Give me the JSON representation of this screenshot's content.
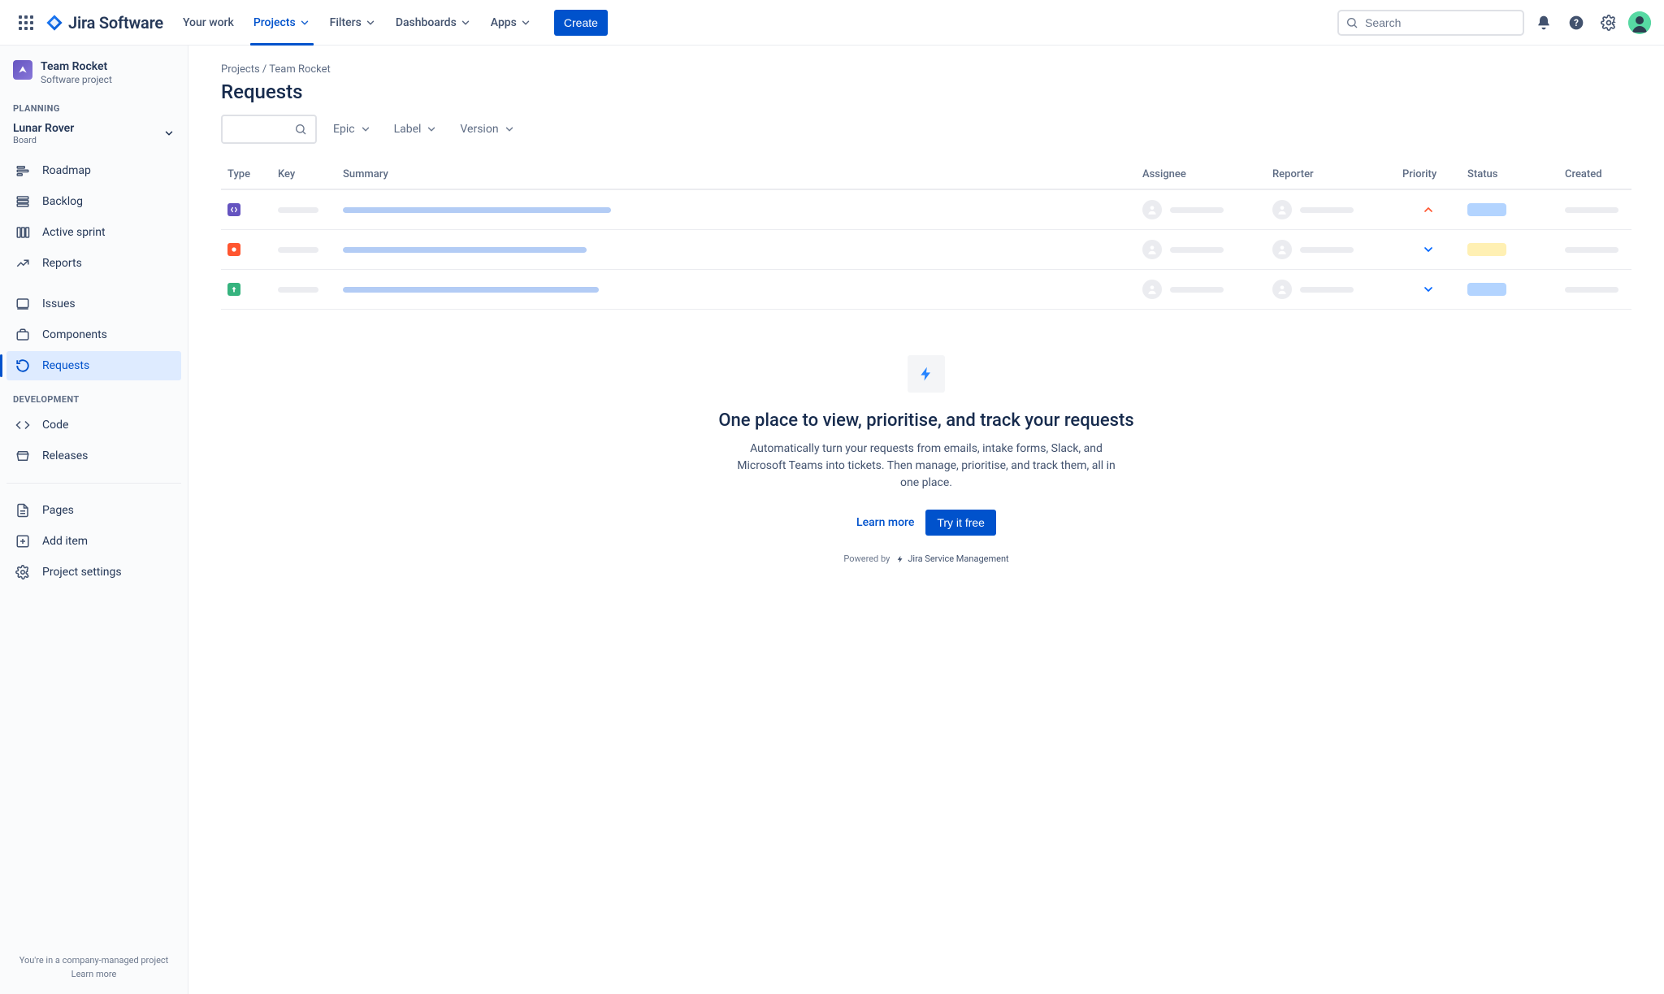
{
  "brand": {
    "name": "Jira Software"
  },
  "topnav": {
    "items": [
      {
        "label": "Your work",
        "dropdown": false,
        "active": false
      },
      {
        "label": "Projects",
        "dropdown": true,
        "active": true
      },
      {
        "label": "Filters",
        "dropdown": true,
        "active": false
      },
      {
        "label": "Dashboards",
        "dropdown": true,
        "active": false
      },
      {
        "label": "Apps",
        "dropdown": true,
        "active": false
      }
    ],
    "create_label": "Create",
    "search_placeholder": "Search"
  },
  "sidebar": {
    "project": {
      "name": "Team Rocket",
      "type": "Software project"
    },
    "sections": {
      "planning_label": "PLANNING",
      "development_label": "DEVELOPMENT"
    },
    "board": {
      "name": "Lunar Rover",
      "subtitle": "Board"
    },
    "planning_items": [
      {
        "icon": "roadmap",
        "label": "Roadmap"
      },
      {
        "icon": "backlog",
        "label": "Backlog"
      },
      {
        "icon": "sprint",
        "label": "Active sprint"
      },
      {
        "icon": "reports",
        "label": "Reports"
      }
    ],
    "planning_items2": [
      {
        "icon": "issues",
        "label": "Issues"
      },
      {
        "icon": "components",
        "label": "Components"
      },
      {
        "icon": "requests",
        "label": "Requests",
        "active": true
      }
    ],
    "dev_items": [
      {
        "icon": "code",
        "label": "Code"
      },
      {
        "icon": "releases",
        "label": "Releases"
      }
    ],
    "extra_items": [
      {
        "icon": "pages",
        "label": "Pages"
      },
      {
        "icon": "additem",
        "label": "Add item"
      },
      {
        "icon": "settings",
        "label": "Project settings"
      }
    ],
    "footer": {
      "line1": "You're in a company-managed project",
      "line2": "Learn more"
    }
  },
  "main": {
    "breadcrumb": {
      "root": "Projects",
      "sep": " / ",
      "leaf": "Team Rocket"
    },
    "page_title": "Requests",
    "filters": [
      {
        "label": "Epic"
      },
      {
        "label": "Label"
      },
      {
        "label": "Version"
      }
    ],
    "columns": [
      {
        "key": "type",
        "label": "Type"
      },
      {
        "key": "keycol",
        "label": "Key"
      },
      {
        "key": "summary",
        "label": "Summary"
      },
      {
        "key": "assignee",
        "label": "Assignee"
      },
      {
        "key": "reporter",
        "label": "Reporter"
      },
      {
        "key": "priority",
        "label": "Priority"
      },
      {
        "key": "status",
        "label": "Status"
      },
      {
        "key": "created",
        "label": "Created"
      }
    ],
    "rows": [
      {
        "type_color": "#6554C0",
        "type_icon": "story",
        "summary_w": 330,
        "priority": "high",
        "status": "blue"
      },
      {
        "type_color": "#FF5630",
        "type_icon": "bug",
        "summary_w": 300,
        "priority": "low",
        "status": "yellow"
      },
      {
        "type_color": "#36B37E",
        "type_icon": "improve",
        "summary_w": 315,
        "priority": "low",
        "status": "blue"
      }
    ]
  },
  "promo": {
    "heading": "One place to view, prioritise, and track your requests",
    "body": "Automatically turn your requests from emails, intake forms, Slack, and Microsoft Teams into tickets. Then manage, prioritise, and track them, all in one place.",
    "learn_more": "Learn more",
    "cta": "Try it free",
    "powered_by": "Powered by",
    "powered_product": "Jira Service Management"
  }
}
